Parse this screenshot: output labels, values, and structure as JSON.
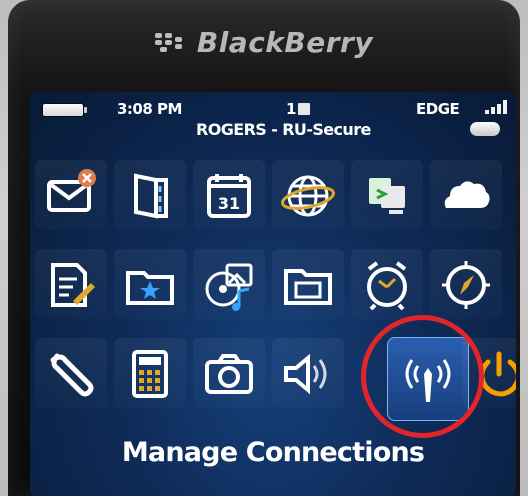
{
  "device": {
    "brand": "BlackBerry"
  },
  "status_bar": {
    "time": "3:08 PM",
    "message_count": "1",
    "carrier": "ROGERS - RU-Secure",
    "network_type": "EDGE",
    "signal_bars": 4
  },
  "home_screen": {
    "icons": [
      {
        "name": "messages-icon"
      },
      {
        "name": "contacts-icon"
      },
      {
        "name": "calendar-icon",
        "text": "31"
      },
      {
        "name": "browser-icon"
      },
      {
        "name": "desktop-manager-icon"
      },
      {
        "name": "cloud-icon"
      },
      {
        "name": "memopad-icon"
      },
      {
        "name": "favorites-folder-icon"
      },
      {
        "name": "media-icon"
      },
      {
        "name": "folder-icon"
      },
      {
        "name": "clock-icon"
      },
      {
        "name": "compass-icon"
      },
      {
        "name": "options-icon"
      },
      {
        "name": "calculator-icon"
      },
      {
        "name": "camera-icon"
      },
      {
        "name": "sound-profiles-icon"
      },
      {
        "name": "manage-connections-icon"
      },
      {
        "name": "power-icon"
      }
    ],
    "selected_label": "Manage Connections"
  },
  "colors": {
    "screen_bg": "#0e2b58",
    "highlight_ring": "#e1252b",
    "power": "#f6a000"
  }
}
